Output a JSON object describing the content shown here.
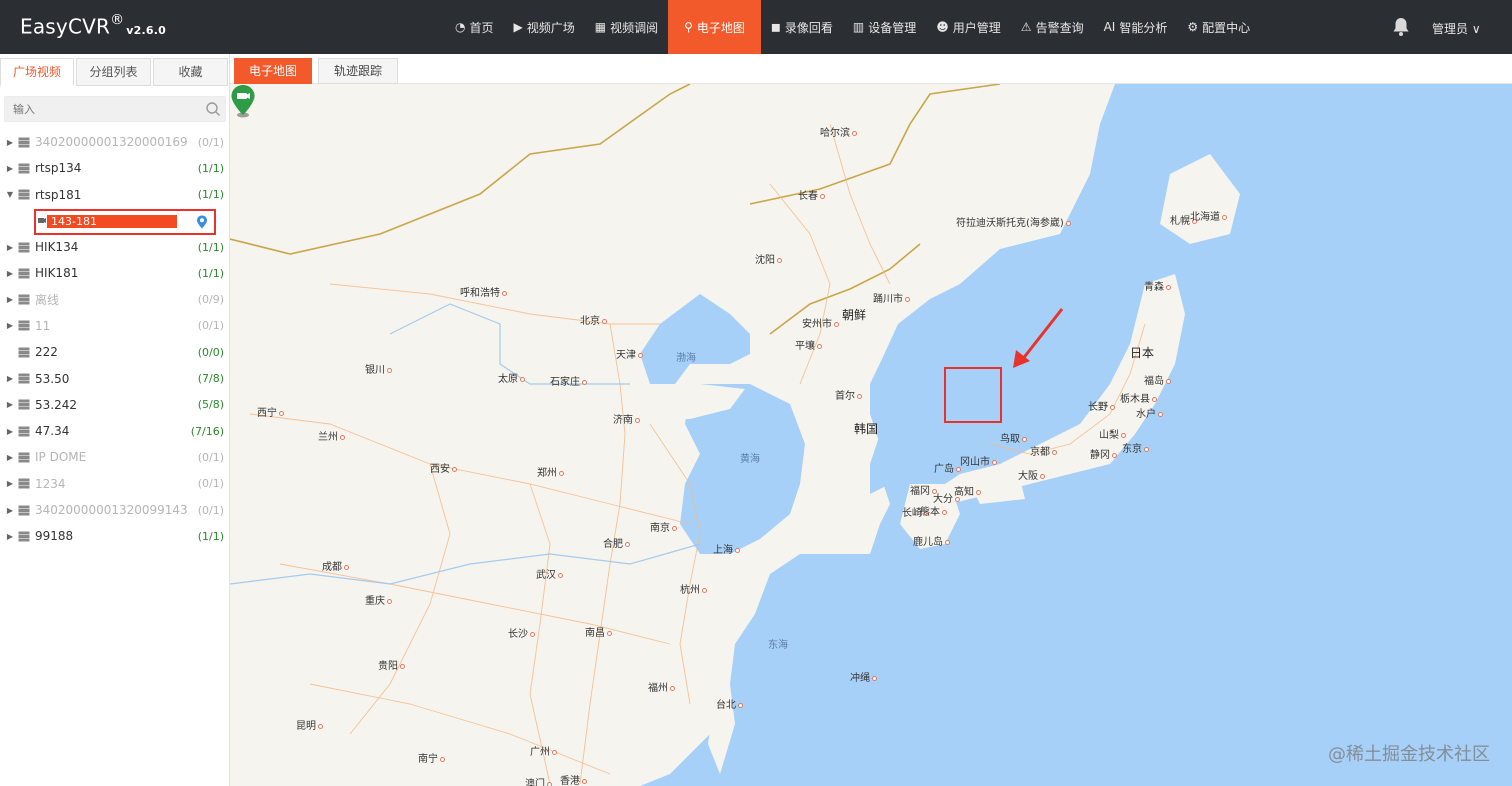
{
  "header": {
    "logo": "EasyCVR",
    "logo_reg": "®",
    "version": "v2.6.0",
    "nav": [
      {
        "icon": "dashboard-icon",
        "glyph": "◔",
        "label": "首页"
      },
      {
        "icon": "play-icon",
        "glyph": "▶",
        "label": "视频广场"
      },
      {
        "icon": "grid-icon",
        "glyph": "▦",
        "label": "视频调阅"
      },
      {
        "icon": "location-pin-icon",
        "glyph": "⚲",
        "label": "电子地图",
        "active": true
      },
      {
        "icon": "video-camera-icon",
        "glyph": "◼",
        "label": "录像回看"
      },
      {
        "icon": "server-icon",
        "glyph": "▥",
        "label": "设备管理"
      },
      {
        "icon": "user-icon",
        "glyph": "☻",
        "label": "用户管理"
      },
      {
        "icon": "alarm-icon",
        "glyph": "⚠",
        "label": "告警查询"
      },
      {
        "icon": "ai-icon",
        "glyph": "AI",
        "label": "智能分析"
      },
      {
        "icon": "gear-icon",
        "glyph": "⚙",
        "label": "配置中心"
      }
    ],
    "user": "管理员 ∨"
  },
  "sidebar": {
    "tabs": [
      "广场视频",
      "分组列表",
      "收藏"
    ],
    "search_placeholder": "输入",
    "tree": [
      {
        "name": "34020000001320000169",
        "count": "(0/1)",
        "online": false,
        "expander": "▶"
      },
      {
        "name": "rtsp134",
        "count": "(1/1)",
        "online": true,
        "expander": "▶"
      },
      {
        "name": "rtsp181",
        "count": "(1/1)",
        "online": true,
        "expander": "▼"
      },
      {
        "name": "HIK134",
        "count": "(1/1)",
        "online": true,
        "expander": "▶"
      },
      {
        "name": "HIK181",
        "count": "(1/1)",
        "online": true,
        "expander": "▶"
      },
      {
        "name": "离线",
        "count": "(0/9)",
        "online": false,
        "expander": "▶"
      },
      {
        "name": "11",
        "count": "(0/1)",
        "online": false,
        "expander": "▶"
      },
      {
        "name": "222",
        "count": "(0/0)",
        "online": true,
        "expander": ""
      },
      {
        "name": "53.50",
        "count": "(7/8)",
        "online": true,
        "expander": "▶"
      },
      {
        "name": "53.242",
        "count": "(5/8)",
        "online": true,
        "expander": "▶"
      },
      {
        "name": "47.34",
        "count": "(7/16)",
        "online": true,
        "expander": "▶"
      },
      {
        "name": "IP DOME",
        "count": "(0/1)",
        "online": false,
        "expander": "▶"
      },
      {
        "name": "1234",
        "count": "(0/1)",
        "online": false,
        "expander": "▶"
      },
      {
        "name": "34020000001320099143",
        "count": "(0/1)",
        "online": false,
        "expander": "▶"
      },
      {
        "name": "99188",
        "count": "(1/1)",
        "online": true,
        "expander": "▶"
      }
    ],
    "selected_child": "143-181"
  },
  "map": {
    "tabs": [
      "电子地图",
      "轨迹跟踪"
    ],
    "cities": [
      "哈尔滨",
      "长春",
      "符拉迪沃斯托克(海参崴)",
      "札幌",
      "北海道",
      "青森",
      "沈阳",
      "呼和浩特",
      "北京",
      "天津",
      "安州市",
      "平壤",
      "踊川市",
      "银川",
      "太原",
      "石家庄",
      "济南",
      "首尔",
      "西宁",
      "兰州",
      "西安",
      "郑州",
      "南京",
      "合肥",
      "上海",
      "杭州",
      "成都",
      "重庆",
      "武汉",
      "长沙",
      "南昌",
      "贵阳",
      "福州",
      "台北",
      "昆明",
      "南宁",
      "广州",
      "澳门",
      "香港",
      "福岛",
      "长野",
      "栃木县",
      "水户",
      "山梨",
      "东京",
      "静冈",
      "鸟取",
      "京都",
      "冈山市",
      "广岛",
      "大阪",
      "福冈",
      "大分",
      "高知",
      "长崎",
      "熊本",
      "鹿儿岛",
      "冲绳"
    ],
    "countries": [
      "朝鲜",
      "韩国",
      "日本"
    ],
    "seas": [
      "渤海",
      "黄海",
      "东海"
    ],
    "colors": {
      "water": "#a6d0f7",
      "land": "#f6f4ee",
      "road": "#f7b985",
      "border": "#c9a64a"
    },
    "watermark": "@稀土掘金技术社区"
  }
}
